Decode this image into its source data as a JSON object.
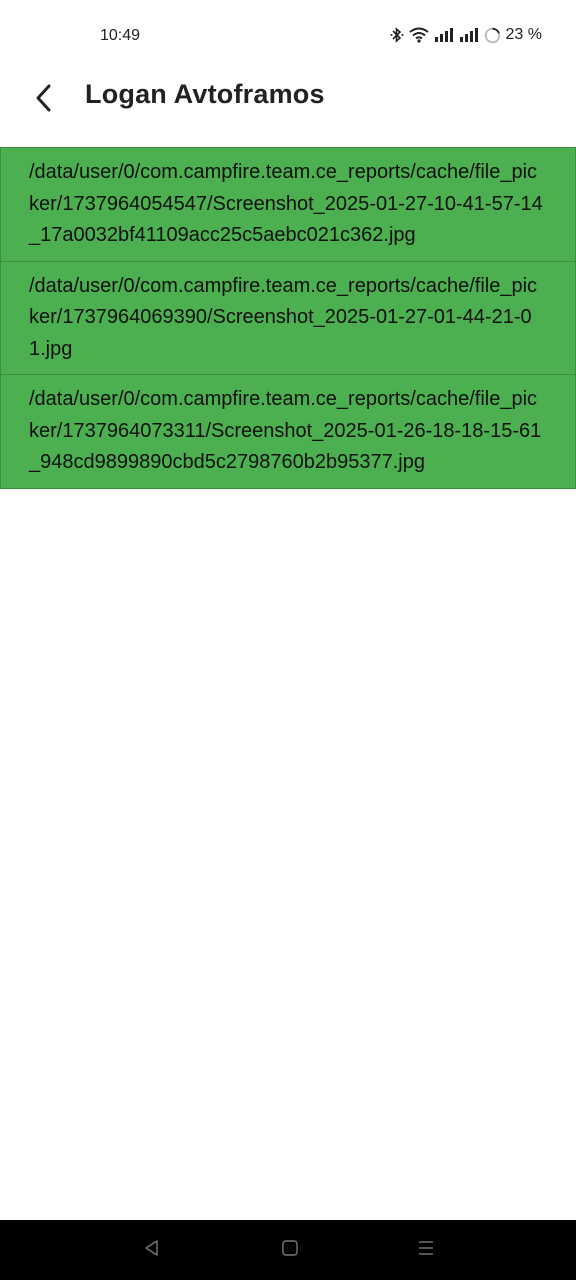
{
  "status_bar": {
    "time": "10:49",
    "battery": "23 %",
    "icons": [
      "bluetooth-icon",
      "wifi-icon",
      "signal-icon",
      "signal-icon",
      "battery-ring-icon"
    ]
  },
  "app_bar": {
    "back_icon": "chevron-left-icon",
    "title": "Logan Avtoframos"
  },
  "files": [
    {
      "path": "/data/user/0/com.campfire.team.ce_reports/cache/file_picker/1737964054547/Screenshot_2025-01-27-10-41-57-14_17a0032bf41109acc25c5aebc021c362.jpg"
    },
    {
      "path": "/data/user/0/com.campfire.team.ce_reports/cache/file_picker/1737964069390/Screenshot_2025-01-27-01-44-21-01.jpg"
    },
    {
      "path": "/data/user/0/com.campfire.team.ce_reports/cache/file_picker/1737964073311/Screenshot_2025-01-26-18-18-15-61_948cd9899890cbd5c2798760b2b95377.jpg"
    }
  ],
  "nav_bar": {
    "icons": [
      "back-triangle-icon",
      "home-square-icon",
      "recents-menu-icon"
    ]
  },
  "colors": {
    "item_background": "#4caf50",
    "nav_background": "#000000",
    "page_background": "#ffffff"
  }
}
